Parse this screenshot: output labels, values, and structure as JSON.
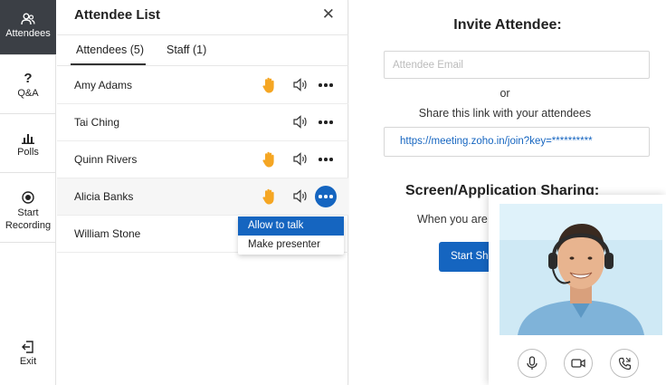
{
  "nav": {
    "items": [
      {
        "label": "Attendees",
        "icon": "people-icon"
      },
      {
        "label": "Q&A",
        "icon": "question-icon"
      },
      {
        "label": "Polls",
        "icon": "bar-chart-icon"
      },
      {
        "label_line1": "Start",
        "label_line2": "Recording",
        "icon": "record-icon"
      },
      {
        "label": "Exit",
        "icon": "exit-icon"
      }
    ]
  },
  "panel": {
    "title": "Attendee List",
    "tabs": [
      {
        "label": "Attendees (5)",
        "active": true
      },
      {
        "label": "Staff (1)",
        "active": false
      }
    ],
    "attendees": [
      {
        "name": "Amy Adams",
        "hand_raised": true
      },
      {
        "name": "Tai Ching",
        "hand_raised": false
      },
      {
        "name": "Quinn Rivers",
        "hand_raised": true
      },
      {
        "name": "Alicia Banks",
        "hand_raised": true
      },
      {
        "name": "William Stone",
        "hand_raised": false
      }
    ],
    "menu": {
      "items": [
        "Allow to talk",
        "Make presenter"
      ],
      "selected": "Allow to talk"
    }
  },
  "invite": {
    "title": "Invite Attendee:",
    "email_placeholder": "Attendee Email",
    "or_text": "or",
    "share_text": "Share this link with your attendees",
    "link": "https://meeting.zoho.in/join?key=**********"
  },
  "screen_sharing": {
    "title": "Screen/Application Sharing:",
    "text": "When you are",
    "button_label": "Start Sh"
  },
  "colors": {
    "accent": "#1565c0",
    "hand": "#f5a623",
    "nav_active": "#3b3f45"
  }
}
